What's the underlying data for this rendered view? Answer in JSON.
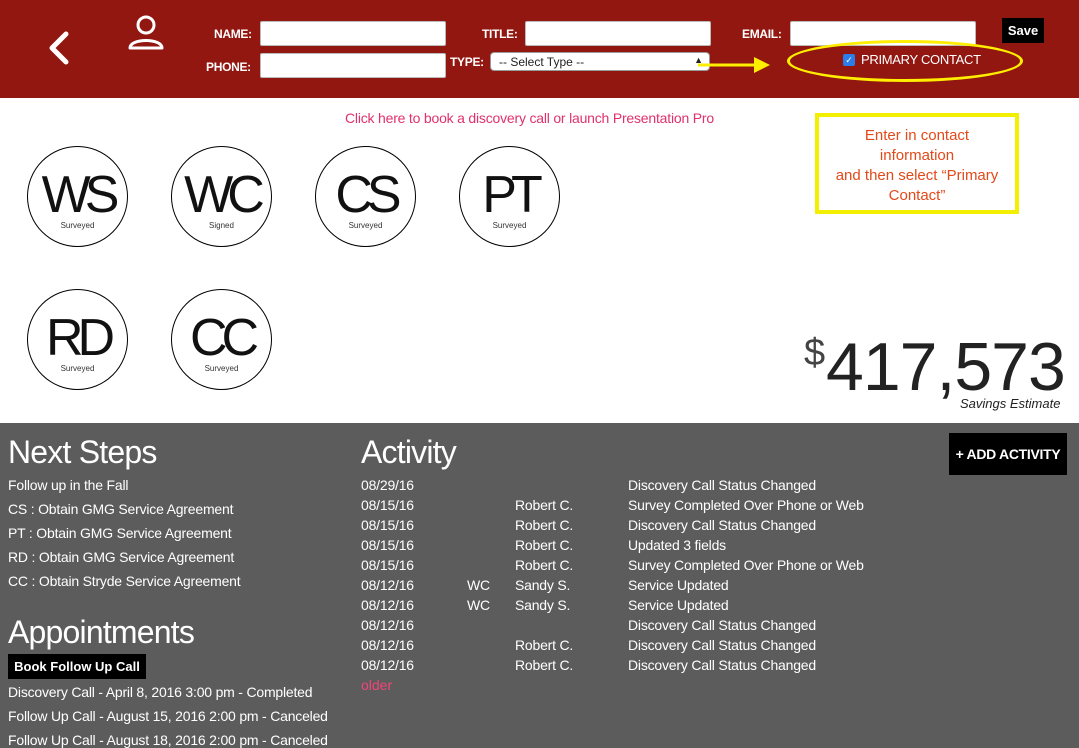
{
  "header": {
    "name_label": "NAME:",
    "title_label": "TITLE:",
    "email_label": "EMAIL:",
    "phone_label": "PHONE:",
    "type_label": "TYPE:",
    "name_value": "",
    "title_value": "",
    "email_value": "",
    "phone_value": "",
    "type_selected": "-- Select Type --",
    "save_label": "Save",
    "primary_contact_label": "PRIMARY CONTACT",
    "primary_contact_checked": true,
    "back_icon": "chevron-left-icon",
    "user_icon": "user-icon"
  },
  "book_link": "Click here to book a discovery call or launch Presentation Pro",
  "annotation_note": {
    "line1": "Enter in contact",
    "line2": "information",
    "line3": "and then select “Primary",
    "line4": "Contact”"
  },
  "services": [
    {
      "code": "WS",
      "status": "Surveyed"
    },
    {
      "code": "WC",
      "status": "Signed"
    },
    {
      "code": "CS",
      "status": "Surveyed"
    },
    {
      "code": "PT",
      "status": "Surveyed"
    },
    {
      "code": "RD",
      "status": "Surveyed"
    },
    {
      "code": "CC",
      "status": "Surveyed"
    }
  ],
  "savings": {
    "currency": "$",
    "amount": "417,573",
    "label": "Savings Estimate"
  },
  "next_steps": {
    "title": "Next Steps",
    "items": [
      "Follow up in the Fall",
      "CS : Obtain GMG Service Agreement",
      "PT : Obtain GMG Service Agreement",
      "RD : Obtain GMG Service Agreement",
      "CC : Obtain Stryde Service Agreement"
    ]
  },
  "appointments": {
    "title": "Appointments",
    "book_button": "Book Follow Up Call",
    "items": [
      "Discovery Call - April 8, 2016 3:00 pm - Completed",
      "Follow Up Call - August 15, 2016 2:00 pm - Canceled",
      "Follow Up Call - August 18, 2016 2:00 pm - Canceled"
    ]
  },
  "activity": {
    "title": "Activity",
    "add_button": "+ ADD ACTIVITY",
    "older_link": "older",
    "rows": [
      {
        "date": "08/29/16",
        "code": "",
        "user": "",
        "desc": "Discovery Call Status Changed"
      },
      {
        "date": "08/15/16",
        "code": "",
        "user": "Robert C.",
        "desc": "Survey Completed Over Phone or Web"
      },
      {
        "date": "08/15/16",
        "code": "",
        "user": "Robert C.",
        "desc": "Discovery Call Status Changed"
      },
      {
        "date": "08/15/16",
        "code": "",
        "user": "Robert C.",
        "desc": "Updated 3 fields"
      },
      {
        "date": "08/15/16",
        "code": "",
        "user": "Robert C.",
        "desc": "Survey Completed Over Phone or Web"
      },
      {
        "date": "08/12/16",
        "code": "WC",
        "user": "Sandy S.",
        "desc": "Service Updated"
      },
      {
        "date": "08/12/16",
        "code": "WC",
        "user": "Sandy S.",
        "desc": "Service Updated"
      },
      {
        "date": "08/12/16",
        "code": "",
        "user": "",
        "desc": "Discovery Call Status Changed"
      },
      {
        "date": "08/12/16",
        "code": "",
        "user": "Robert C.",
        "desc": "Discovery Call Status Changed"
      },
      {
        "date": "08/12/16",
        "code": "",
        "user": "Robert C.",
        "desc": "Discovery Call Status Changed"
      }
    ]
  },
  "colors": {
    "header_bg": "#931711",
    "highlight_yellow": "#ffee00",
    "link_pink": "#e0316c",
    "panel_gray": "#5c5c5c"
  }
}
